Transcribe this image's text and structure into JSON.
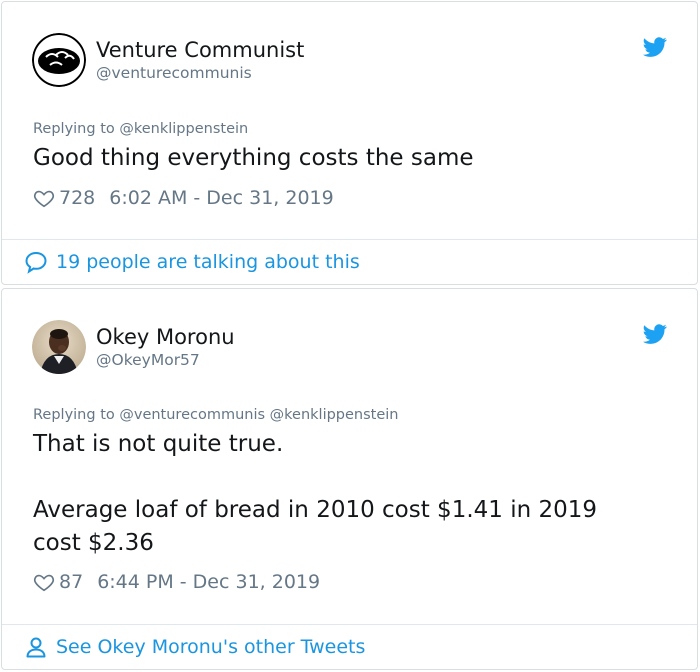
{
  "tweets": [
    {
      "display_name": "Venture Communist",
      "handle": "@venturecommunis",
      "replying_prefix": "Replying to",
      "replying_to": "@kenklippenstein",
      "text_lines": [
        "Good thing everything costs the same"
      ],
      "likes": "728",
      "timestamp": "6:02 AM - Dec 31, 2019",
      "footer_label": "19 people are talking about this",
      "footer_icon": "comment-bubble-icon"
    },
    {
      "display_name": "Okey Moronu",
      "handle": "@OkeyMor57",
      "replying_prefix": "Replying to",
      "replying_to": "@venturecommunis @kenklippenstein",
      "text_lines": [
        "That is not quite true.",
        "",
        "Average loaf of bread in 2010 cost $1.41 in 2019",
        "cost $2.36"
      ],
      "likes": "87",
      "timestamp": "6:44 PM - Dec 31, 2019",
      "footer_label": "See Okey Moronu's other Tweets",
      "footer_icon": "person-icon"
    }
  ],
  "colors": {
    "twitter_blue": "#1da1f2",
    "link_blue": "#1b95e0",
    "muted_gray": "#657786",
    "text": "#14171a"
  }
}
